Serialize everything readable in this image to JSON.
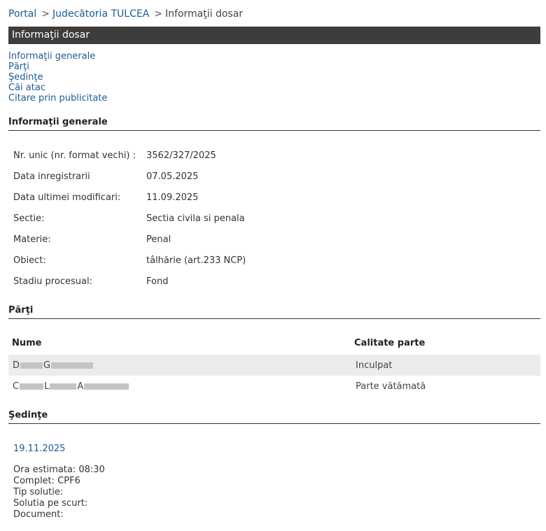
{
  "breadcrumb": {
    "portal": "Portal",
    "court": "Judecătoria TULCEA",
    "current": "Informaţii dosar",
    "separator": ">"
  },
  "page_title": "Informaţii dosar",
  "toc": [
    "Informaţii generale",
    "Părţi",
    "Şedinţe",
    "Căi atac",
    "Citare prin publicitate"
  ],
  "general": {
    "heading": "Informaţii generale",
    "rows": [
      {
        "label": "Nr. unic (nr. format vechi) :",
        "value": "3562/327/2025"
      },
      {
        "label": "Data inregistrarii",
        "value": "07.05.2025"
      },
      {
        "label": "Data ultimei modificari:",
        "value": "11.09.2025"
      },
      {
        "label": "Sectie:",
        "value": "Sectia civila si penala"
      },
      {
        "label": "Materie:",
        "value": "Penal"
      },
      {
        "label": "Obiect:",
        "value": "tâlhărie (art.233 NCP)"
      },
      {
        "label": "Stadiu procesual:",
        "value": "Fond"
      }
    ]
  },
  "parties": {
    "heading": "Părţi",
    "col_name": "Nume",
    "col_role": "Calitate parte",
    "rows": [
      {
        "initials": [
          "D",
          "G"
        ],
        "role": "Inculpat"
      },
      {
        "initials": [
          "C",
          "L",
          "A"
        ],
        "role": "Parte vătămată"
      }
    ]
  },
  "sessions": {
    "heading": "Şedinţe",
    "date": "19.11.2025",
    "lines": [
      "Ora estimata: 08:30",
      "Complet: CPF6",
      "Tip solutie:",
      "Solutia pe scurt:",
      "Document:"
    ]
  }
}
